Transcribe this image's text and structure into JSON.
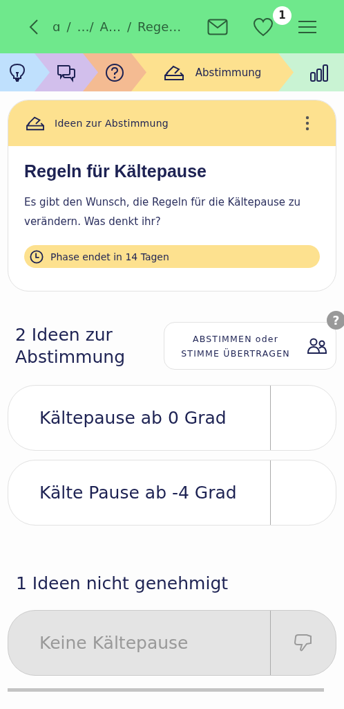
{
  "top_bar": {
    "breadcrumbs": [
      "ɑ",
      "/",
      "…/",
      "A…",
      "/",
      "Rege…"
    ],
    "notification_count": "1"
  },
  "phase_steps": [
    {
      "kind": "ideas",
      "color": "#bfe0fd",
      "selected": false
    },
    {
      "kind": "discussion",
      "color": "#d2bfec",
      "selected": false
    },
    {
      "kind": "questions",
      "color": "#f4bb92",
      "selected": false
    },
    {
      "kind": "voting",
      "color": "#fde18f",
      "selected": true,
      "label": "Abstimmung"
    },
    {
      "kind": "results",
      "color": "#c9f3d3",
      "selected": false
    }
  ],
  "info_card": {
    "header": "Ideen zur Abstimmung",
    "title": "Regeln für Kältepause",
    "description": "Es gibt den Wunsch, die Regeln für die Kältepause zu verändern. Was denkt ihr?",
    "phase_note": "Phase endet in 14 Tagen"
  },
  "voting_section": {
    "heading": "2 Ideen zur Abstimmung",
    "vote_button": [
      "ABSTIMMEN oder",
      "STIMME ÜBERTRAGEN"
    ],
    "help": "?",
    "ideas": [
      {
        "title": "Kältepause ab 0 Grad",
        "rejected": false
      },
      {
        "title": "Kälte Pause ab -4 Grad",
        "rejected": false
      }
    ]
  },
  "rejected_section": {
    "heading": "1 Ideen nicht genehmigt",
    "ideas": [
      {
        "title": "Keine Kältepause",
        "rejected": true
      }
    ]
  }
}
